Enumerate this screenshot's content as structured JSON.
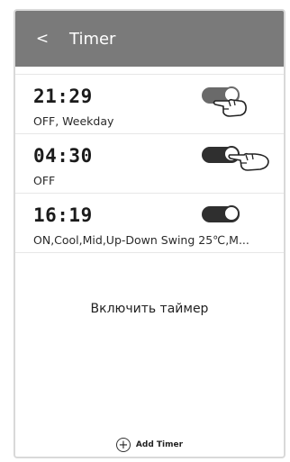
{
  "header": {
    "back_label": "<",
    "title": "Timer"
  },
  "timers": [
    {
      "time": "21:29",
      "description": "OFF, Weekday",
      "enabled": true
    },
    {
      "time": "04:30",
      "description": "OFF",
      "enabled": true
    },
    {
      "time": "16:19",
      "description": "ON,Cool,Mid,Up-Down Swing 25℃,M...",
      "enabled": true
    }
  ],
  "enable_timer_label": "Включить таймер",
  "add_timer": {
    "icon": "plus-icon",
    "label": "Add Timer"
  },
  "colors": {
    "header_bg": "#7a7a7a",
    "toggle_on": "#2f2f2f",
    "toggle_pressed": "#6a6a6a"
  }
}
